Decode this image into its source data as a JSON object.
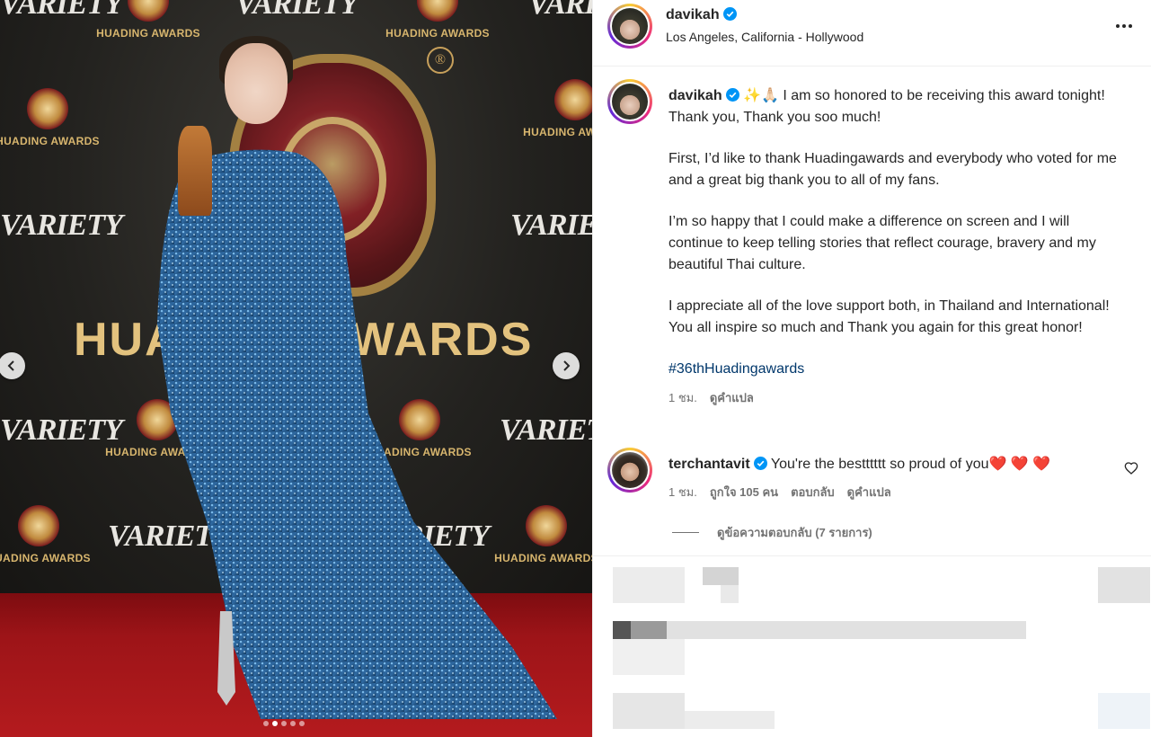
{
  "media": {
    "backdrop_texts": {
      "variety": "VARIETY",
      "huading": "HUADING AWARDS",
      "big": "HUADING AWARDS",
      "registered": "®"
    },
    "carousel": {
      "count": 5,
      "active_index": 1
    }
  },
  "post": {
    "author": {
      "username": "davikah",
      "verified": true,
      "location": "Los Angeles, California - Hollywood"
    },
    "caption": {
      "username": "davikah",
      "emoji": "✨🙏🏻",
      "paragraphs": [
        "I am so honored to be receiving this award tonight! Thank you, Thank you soo much!",
        "First, I’d like to thank Huadingawards and everybody who voted for me and a great big thank you to all of my fans.",
        "I’m so happy that I could make a difference on screen and I will continue to keep telling stories that reflect courage, bravery and my beautiful Thai culture.",
        "I appreciate all of the love support both, in Thailand and International! You all inspire so much and Thank you again for this great honor!"
      ],
      "hashtag": "#36thHuadingawards",
      "time": "1 ชม.",
      "translate": "ดูคำแปล"
    },
    "comments": [
      {
        "username": "terchantavit",
        "verified": true,
        "text": "You're the bestttttt so proud of you",
        "hearts": "❤️ ❤️ ❤️",
        "time": "1 ชม.",
        "likes": "ถูกใจ 105 คน",
        "reply": "ตอบกลับ",
        "translate": "ดูคำแปล",
        "view_replies": "ดูข้อความตอบกลับ (7 รายการ)"
      }
    ]
  },
  "colors": {
    "link": "#00376b",
    "muted": "#737373",
    "verified": "#0095f6",
    "heart": "#ed4956"
  }
}
